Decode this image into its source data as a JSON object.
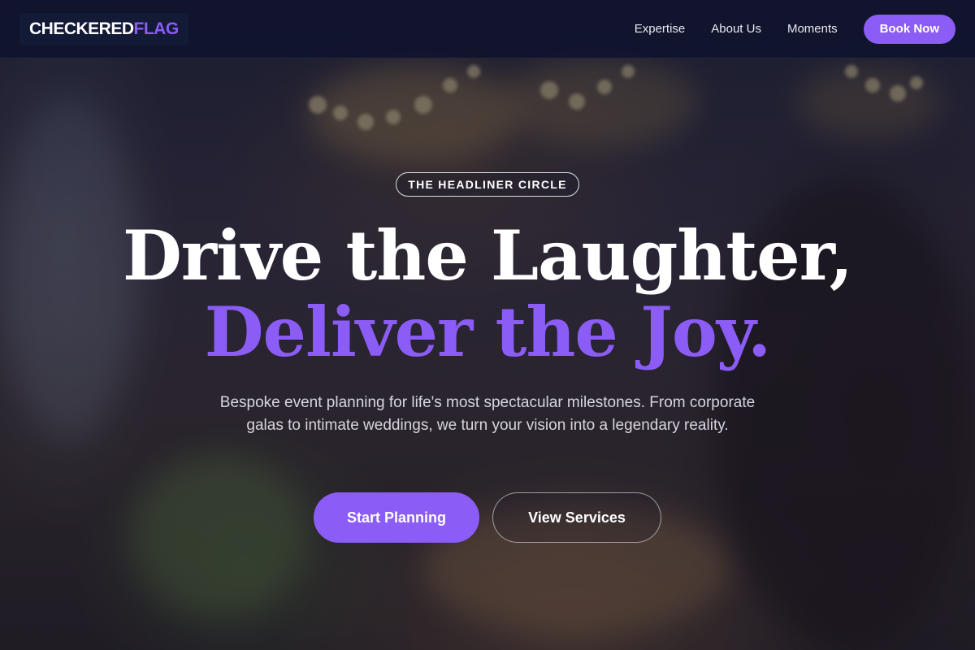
{
  "nav": {
    "logo_part1": "CHECKERED",
    "logo_part2": "FLAG",
    "links": [
      "Expertise",
      "About Us",
      "Moments"
    ],
    "cta": "Book Now"
  },
  "hero": {
    "badge": "THE HEADLINER CIRCLE",
    "headline_line1": "Drive the Laughter,",
    "headline_line2": "Deliver the Joy.",
    "subtext": "Bespoke event planning for life's most spectacular milestones. From corporate galas to intimate weddings, we turn your vision into a legendary reality.",
    "primary_cta": "Start Planning",
    "secondary_cta": "View Services"
  },
  "colors": {
    "accent": "#8b5cf6",
    "nav_bg": "#10142c",
    "text_light": "#ffffff"
  }
}
